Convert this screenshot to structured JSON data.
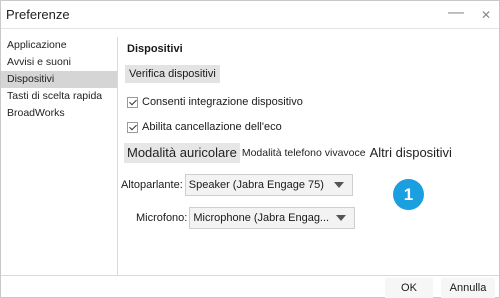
{
  "window": {
    "title": "Preferenze",
    "minimize_glyph": "—",
    "close_glyph": "✕"
  },
  "sidebar": {
    "items": [
      {
        "label": "Applicazione"
      },
      {
        "label": "Avvisi e suoni"
      },
      {
        "label": "Dispositivi",
        "selected": true
      },
      {
        "label": "Tasti di scelta rapida"
      },
      {
        "label": "BroadWorks"
      }
    ]
  },
  "main": {
    "heading": "Dispositivi",
    "verify_button": "Verifica dispositivi",
    "checkboxes": [
      {
        "label": "Consenti integrazione dispositivo",
        "checked": true
      },
      {
        "label": "Abilita cancellazione dell'eco",
        "checked": true
      }
    ],
    "tabs": [
      {
        "label": "Modalità auricolare",
        "active": true
      },
      {
        "label": "Modalità telefono vivavoce"
      },
      {
        "label": "Altri dispositivi"
      }
    ],
    "speaker": {
      "label": "Altoparlante:",
      "value": "Speaker (Jabra Engage 75)"
    },
    "microphone": {
      "label": "Microfono:",
      "value": "Microphone (Jabra Engag..."
    },
    "badge": "1"
  },
  "footer": {
    "ok": "OK",
    "cancel": "Annulla"
  },
  "colors": {
    "badge": "#1a9fe0",
    "selected_item": "#d5d5d5"
  }
}
